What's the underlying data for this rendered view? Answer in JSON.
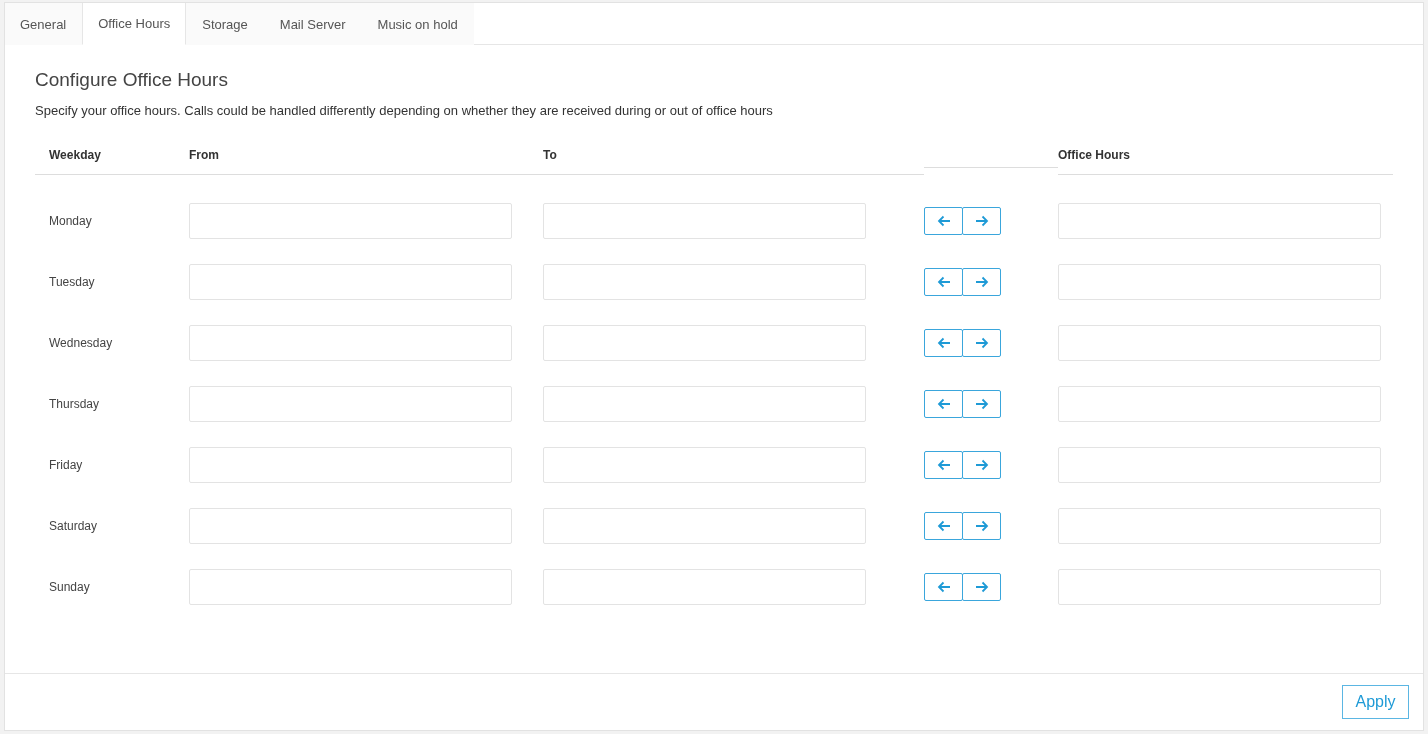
{
  "tabs": [
    {
      "label": "General",
      "selected": false
    },
    {
      "label": "Office Hours",
      "selected": true
    },
    {
      "label": "Storage",
      "selected": false
    },
    {
      "label": "Mail Server",
      "selected": false
    },
    {
      "label": "Music on hold",
      "selected": false
    }
  ],
  "heading": "Configure Office Hours",
  "description": "Specify your office hours. Calls could be handled differently depending on whether they are received during or out of office hours",
  "table": {
    "columns": [
      "Weekday",
      "From",
      "To",
      "Office Hours"
    ],
    "rows": [
      {
        "weekday": "Monday"
      },
      {
        "weekday": "Tuesday"
      },
      {
        "weekday": "Wednesday"
      },
      {
        "weekday": "Thursday"
      },
      {
        "weekday": "Friday"
      },
      {
        "weekday": "Saturday"
      },
      {
        "weekday": "Sunday"
      }
    ]
  },
  "buttons": [
    "Apply"
  ]
}
